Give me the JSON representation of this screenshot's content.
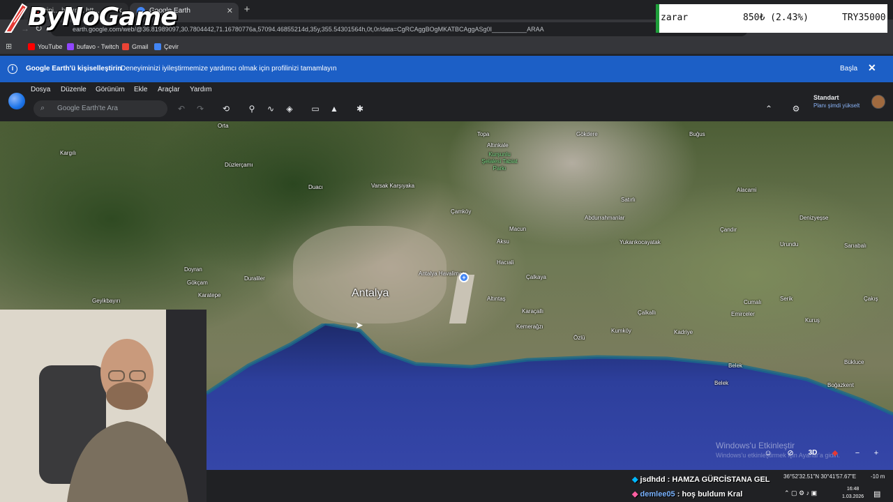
{
  "browser": {
    "tabs": [
      {
        "label": "çini... hazırlık htt...",
        "color": "#c5221f"
      },
      {
        "label": "Google Earth",
        "color": "#4285f4"
      }
    ],
    "url": "earth.google.com/web/@36.81989097,30.7804442,71.16780776a,57094.46855214d,35y,355.54301564h,0t,0r/data=CgRCAggBOgMKATBCAggASg0I__________ARAA",
    "bookmarks": [
      "YouTube",
      "bufavo - Twitch",
      "Gmail",
      "Çevir"
    ],
    "bookmark_colors": [
      "#ff0000",
      "#9146ff",
      "#ea4335",
      "#4285f4"
    ]
  },
  "overlay": {
    "logo": "ByNoGame",
    "stock": {
      "label": "zarar",
      "change": "850₺ (2.43%)",
      "total": "TRY35000",
      "accent": "#1e9e3a"
    }
  },
  "banner": {
    "title": "Google Earth'ü kişiselleştirin",
    "message": "Deneyiminizi iyileştirmemize yardımcı olmak için profilinizi tamamlayın",
    "action": "Başla",
    "color": "#1c5fc6"
  },
  "earth": {
    "menus": [
      "Dosya",
      "Düzenle",
      "Görünüm",
      "Ekle",
      "Araçlar",
      "Yardım"
    ],
    "search_placeholder": "Google Earth'te Ara",
    "plan": {
      "name": "Standart",
      "upgrade": "Planı şimdi yükselt"
    }
  },
  "map": {
    "city": "Antalya",
    "places": [
      {
        "name": "Orta"
      },
      {
        "name": "Topa"
      },
      {
        "name": "Gökdere"
      },
      {
        "name": "Buğus"
      },
      {
        "name": "Kargılı"
      },
      {
        "name": "Düzlerçamı"
      },
      {
        "name": "Duacı"
      },
      {
        "name": "Varsak Karşıyaka"
      },
      {
        "name": "Çamköy"
      },
      {
        "name": "Altınkale"
      },
      {
        "name": "Alacami"
      },
      {
        "name": "Satırlı"
      },
      {
        "name": "Abdurrahmanlar"
      },
      {
        "name": "Denizyeşse"
      },
      {
        "name": "Macun"
      },
      {
        "name": "Aksu"
      },
      {
        "name": "Yukarıkocayatak"
      },
      {
        "name": "Çandır"
      },
      {
        "name": "Urundu"
      },
      {
        "name": "Sarıabalı"
      },
      {
        "name": "Doyran"
      },
      {
        "name": "Duraliler"
      },
      {
        "name": "Gökçam"
      },
      {
        "name": "Karatepe"
      },
      {
        "name": "Geyikbayırı"
      },
      {
        "name": "Hacıali"
      },
      {
        "name": "Çalkaya"
      },
      {
        "name": "Altıntaş"
      },
      {
        "name": "Karaçallı"
      },
      {
        "name": "Kemerağzı"
      },
      {
        "name": "Kumköy"
      },
      {
        "name": "Kadriye"
      },
      {
        "name": "Cumalı"
      },
      {
        "name": "Serik"
      },
      {
        "name": "Çakış"
      },
      {
        "name": "Emirceler"
      },
      {
        "name": "Çalkallı"
      },
      {
        "name": "Kuruş"
      },
      {
        "name": "Özlü"
      },
      {
        "name": "Belek"
      },
      {
        "name": "Belek"
      },
      {
        "name": "Bükluce"
      },
      {
        "name": "Boğazkent"
      }
    ],
    "airport": "Antalya Havalimanı",
    "park": "Kurşunlu Şelalesi Tabiat Parkı",
    "watermark": "Windows'u Etkinleştir",
    "watermark_sub": "Windows'u etkinleştirmek için Ayarlar'a gidin.",
    "view_mode": "3D",
    "coords": "36°52'32.51\"N 30°41'57.67\"E",
    "elevation": "-10 m"
  },
  "stream_chat": [
    {
      "user": "jsdhdd",
      "message": "HAMZA GÜRCİSTANA GEL",
      "color": "#ffffff"
    },
    {
      "user": "demlee05",
      "message": "hoş buldum Kral",
      "color": "#7ab3ff"
    }
  ],
  "tray": {
    "time": "16:48",
    "date": "1.03.2026"
  }
}
